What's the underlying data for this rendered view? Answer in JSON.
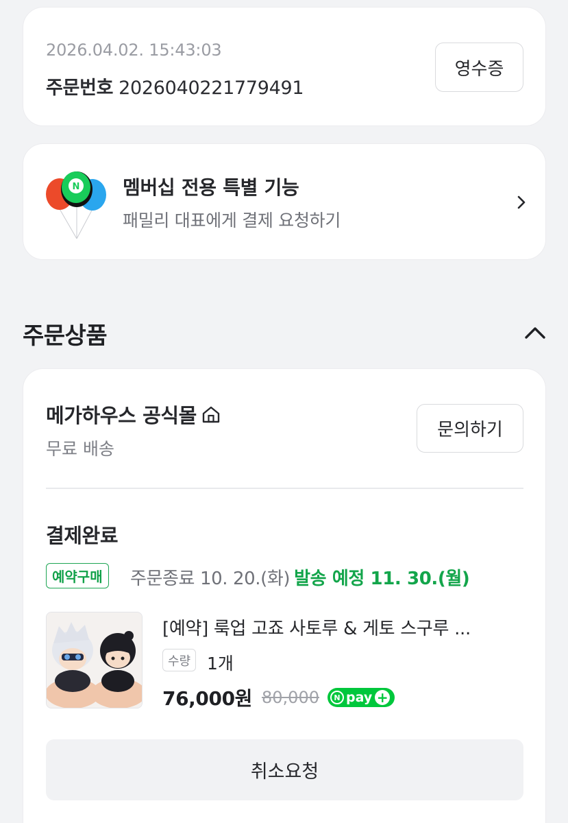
{
  "order": {
    "datetime": "2026.04.02. 15:43:03",
    "number_label": "주문번호",
    "number": "2026040221779491",
    "receipt_button": "영수증"
  },
  "membership": {
    "title": "멤버십 전용 특별 기능",
    "subtitle": "패밀리 대표에게 결제 요청하기",
    "icon": "balloons-icon",
    "badge_letter": "N"
  },
  "section": {
    "title": "주문상품",
    "toggle_icon": "chevron-up-icon"
  },
  "store": {
    "name": "메가하우스 공식몰",
    "shipping": "무료 배송",
    "inquiry_button": "문의하기"
  },
  "item": {
    "status": "결제완료",
    "preorder_badge": "예약구매",
    "order_end": "주문종료 10. 20.(화)",
    "ship_schedule": "발송 예정 11. 30.(월)",
    "product_name": "[예약] 룩업 고죠 사토루 & 게토 스구루 ...",
    "qty_label": "수량",
    "qty_value": "1개",
    "price": "76,000원",
    "original_price": "80,000",
    "npay_label": "pay",
    "npay_letter": "N",
    "npay_plus": "+",
    "cancel_button": "취소요청"
  },
  "colors": {
    "background": "#f2f3f5",
    "accent_green": "#13a54b",
    "npay_green": "#00c73c"
  }
}
